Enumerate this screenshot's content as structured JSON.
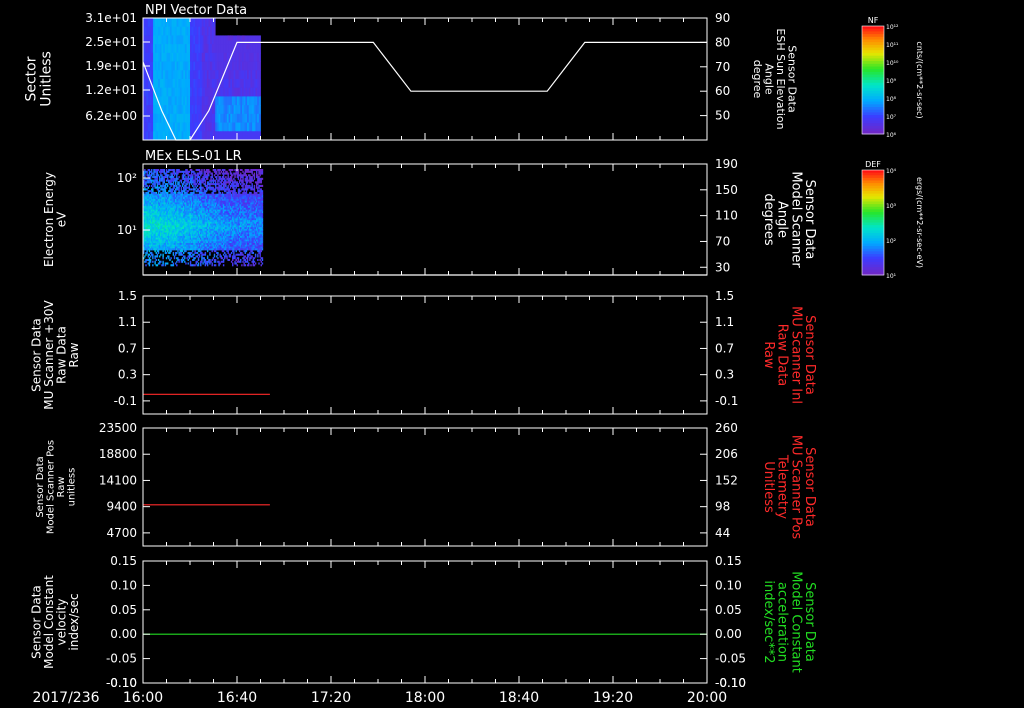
{
  "date_label": "2017/236",
  "time_axis": {
    "ticks": [
      "16:00",
      "16:40",
      "17:20",
      "18:00",
      "18:40",
      "19:20",
      "20:00"
    ],
    "range_minutes": [
      0,
      240
    ]
  },
  "colorbars": [
    {
      "label": "NF",
      "unit": "cnts/(cm**2-sr-sec)",
      "tick_labels": [
        "10¹²",
        "10¹¹",
        "10¹⁰",
        "10⁹",
        "10⁸",
        "10⁷",
        "10⁶"
      ]
    },
    {
      "label": "DEF",
      "unit": "ergs/(cm**2-sr-sec-eV)",
      "tick_labels": [
        "10⁴",
        "10³",
        "10²",
        "10¹"
      ]
    }
  ],
  "chart_data": [
    {
      "type": "heatmap",
      "title": "NPI Vector Data",
      "ylabel": "Sector\nUnitless",
      "yticks": [
        "3.1e+01",
        "2.5e+01",
        "1.9e+01",
        "1.2e+01",
        "6.2e+00"
      ],
      "data_time_range_minutes": [
        0,
        50
      ],
      "colorbar": "NF",
      "overlay": {
        "type": "line",
        "ylabel_right": "Sensor Data\nESH Sun Elevation\nAngle\ndegree",
        "yticks_right": [
          "90",
          "80",
          "70",
          "60",
          "50"
        ],
        "ylim_right": [
          40,
          90
        ],
        "x_minutes": [
          0,
          8,
          14,
          20,
          28,
          40,
          60,
          98,
          106,
          114,
          140,
          172,
          180,
          188,
          240
        ],
        "y_degrees": [
          72,
          52,
          40,
          40,
          52,
          80,
          80,
          80,
          70,
          60,
          60,
          60,
          70,
          80,
          80
        ]
      }
    },
    {
      "type": "heatmap",
      "title": "MEx ELS-01 LR",
      "ylabel": "Electron Energy\neV",
      "yticks": [
        "10²",
        "10¹"
      ],
      "ylim": [
        1.5,
        200
      ],
      "log_y": true,
      "data_time_range_minutes": [
        0,
        51
      ],
      "colorbar": "DEF",
      "overlay": {
        "type": "line",
        "ylabel_right": "Sensor Data\nModel Scanner\nAngle\ndegrees",
        "yticks_right": [
          "190",
          "150",
          "110",
          "70",
          "30"
        ],
        "ylim_right": [
          10,
          190
        ],
        "x_minutes": [
          0,
          240
        ],
        "y_degrees": [
          10,
          10
        ]
      }
    },
    {
      "type": "line",
      "ylabel": "Sensor Data\nMU Scanner +30V\nRaw Data\nRaw",
      "ylabel_right": "Sensor Data\nMU Scanner Inl\nRaw Data\nRaw",
      "yticks": [
        "1.5",
        "1.1",
        "0.7",
        "0.3",
        "-0.1"
      ],
      "yticks_right": [
        "1.5",
        "1.1",
        "0.7",
        "0.3",
        "-0.1"
      ],
      "ylim": [
        -0.3,
        1.5
      ],
      "series": [
        {
          "color": "#ff2a2a",
          "x_minutes": [
            0,
            54
          ],
          "y": [
            0.0,
            0.0
          ]
        }
      ]
    },
    {
      "type": "line",
      "ylabel": "Sensor Data\nModel Scanner Pos\nRaw\nunitless",
      "ylabel_right": "Sensor Data\nMU Scanner Pos\nTelemetry\nUnitless",
      "yticks": [
        "23500",
        "18800",
        "14100",
        "9400",
        "4700"
      ],
      "yticks_right": [
        "260",
        "206",
        "152",
        "98",
        "44"
      ],
      "ylim": [
        0,
        23500
      ],
      "series": [
        {
          "color": "#ff2a2a",
          "x_minutes": [
            0,
            54
          ],
          "y": [
            8200,
            8200
          ]
        }
      ]
    },
    {
      "type": "line",
      "ylabel": "Sensor Data\nModel Constant\nvelocity\nindex/sec",
      "ylabel_right": "Sensor Data\nModel Constant\nacceleration\nindex/sec**2",
      "yticks": [
        "0.15",
        "0.10",
        "0.05",
        "0.00",
        "-0.05",
        "-0.10"
      ],
      "yticks_right": [
        "0.15",
        "0.10",
        "0.05",
        "0.00",
        "-0.05",
        "-0.10"
      ],
      "ylim": [
        -0.1,
        0.15
      ],
      "series": [
        {
          "color": "#22dd22",
          "x_minutes": [
            0,
            240
          ],
          "y": [
            0.0,
            0.0
          ]
        }
      ]
    }
  ]
}
